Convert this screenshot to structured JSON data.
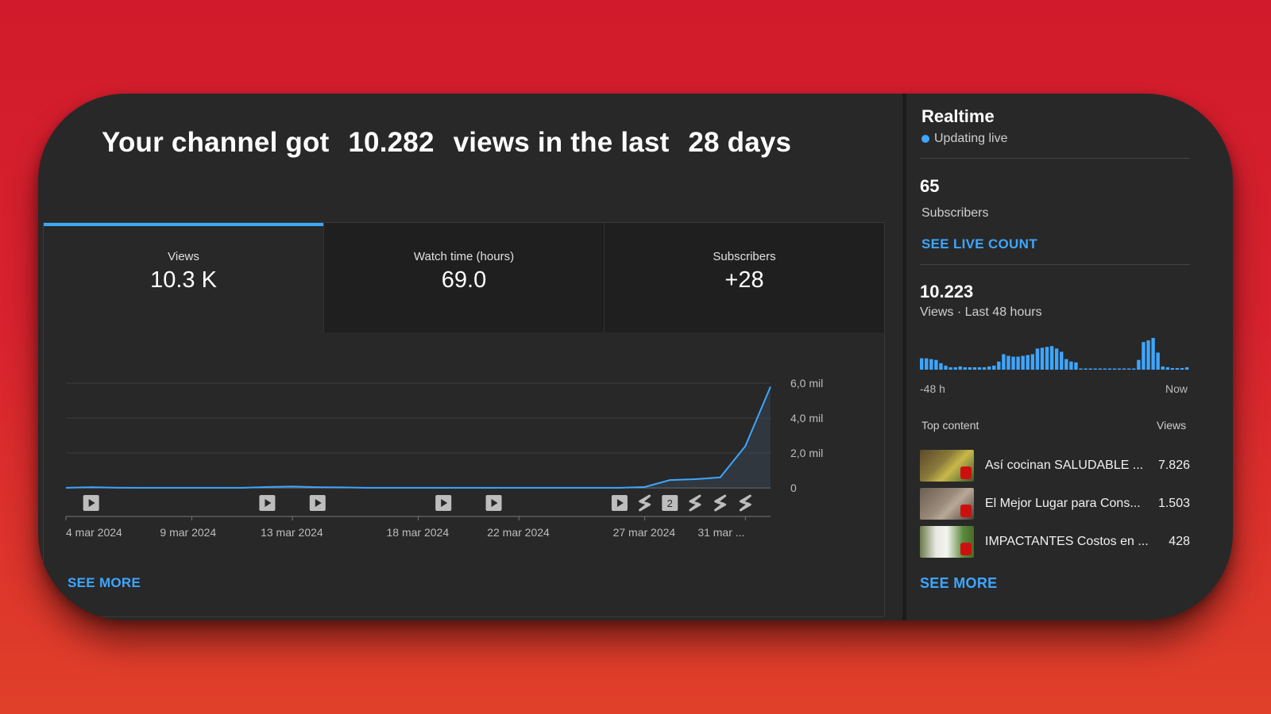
{
  "headline": {
    "prefix": "Your channel got",
    "views": "10.282",
    "middle": "views in the last",
    "period": "28 days"
  },
  "tabs": [
    {
      "label": "Views",
      "value": "10.3 K",
      "active": true
    },
    {
      "label": "Watch time (hours)",
      "value": "69.0",
      "active": false
    },
    {
      "label": "Subscribers",
      "value": "+28",
      "active": false
    }
  ],
  "chart_data": {
    "type": "area",
    "x": [
      "4 mar",
      "5 mar",
      "6 mar",
      "7 mar",
      "8 mar",
      "9 mar",
      "10 mar",
      "11 mar",
      "12 mar",
      "13 mar",
      "14 mar",
      "15 mar",
      "16 mar",
      "17 mar",
      "18 mar",
      "19 mar",
      "20 mar",
      "21 mar",
      "22 mar",
      "23 mar",
      "24 mar",
      "25 mar",
      "26 mar",
      "27 mar",
      "28 mar",
      "29 mar",
      "30 mar",
      "31 mar"
    ],
    "values": [
      5,
      40,
      10,
      5,
      5,
      5,
      5,
      5,
      50,
      80,
      40,
      30,
      5,
      5,
      5,
      5,
      5,
      5,
      5,
      5,
      5,
      5,
      5,
      50,
      450,
      500,
      600,
      2400,
      5800
    ],
    "x_tick_labels": [
      "4 mar 2024",
      "9 mar 2024",
      "13 mar 2024",
      "18 mar 2024",
      "22 mar 2024",
      "27 mar 2024",
      "31 mar ..."
    ],
    "y_tick_labels": [
      "6,0 mil",
      "4,0 mil",
      "2,0 mil",
      "0"
    ],
    "ylim": [
      0,
      6000
    ],
    "grid": true,
    "line_color": "#3ea6ff",
    "markers": [
      {
        "kind": "video",
        "day": 1
      },
      {
        "kind": "video",
        "day": 8
      },
      {
        "kind": "video",
        "day": 10
      },
      {
        "kind": "video",
        "day": 15
      },
      {
        "kind": "video",
        "day": 17
      },
      {
        "kind": "video",
        "day": 22
      },
      {
        "kind": "short",
        "day": 23
      },
      {
        "kind": "count",
        "day": 24,
        "label": "2"
      },
      {
        "kind": "short",
        "day": 25
      },
      {
        "kind": "short",
        "day": 26
      },
      {
        "kind": "short",
        "day": 27
      }
    ]
  },
  "see_more_left": "SEE MORE",
  "realtime": {
    "title": "Realtime",
    "status": "Updating live",
    "subscribers_count": "65",
    "subscribers_label": "Subscribers",
    "see_live_count": "SEE LIVE COUNT",
    "views_48h": "10.223",
    "views_48h_label": "Views · Last 48 hours",
    "bars": [
      14,
      14,
      13,
      12,
      8,
      5,
      3,
      3,
      4,
      3,
      3,
      3,
      3,
      3,
      4,
      5,
      10,
      19,
      17,
      16,
      16,
      17,
      18,
      19,
      26,
      27,
      28,
      29,
      26,
      22,
      13,
      10,
      9,
      0,
      0,
      0,
      0,
      0,
      0,
      0,
      0,
      0,
      0,
      0,
      0,
      12,
      34,
      36,
      39,
      21,
      4,
      3,
      2,
      2,
      2,
      3
    ],
    "axis_start": "-48 h",
    "axis_end": "Now",
    "top_content_label": "Top content",
    "views_col_label": "Views",
    "top_content": [
      {
        "title": "Así cocinan SALUDABLE ...",
        "views": "7.826"
      },
      {
        "title": "El Mejor Lugar para Cons...",
        "views": "1.503"
      },
      {
        "title": "IMPACTANTES Costos en ...",
        "views": "428"
      }
    ],
    "see_more": "SEE MORE"
  }
}
